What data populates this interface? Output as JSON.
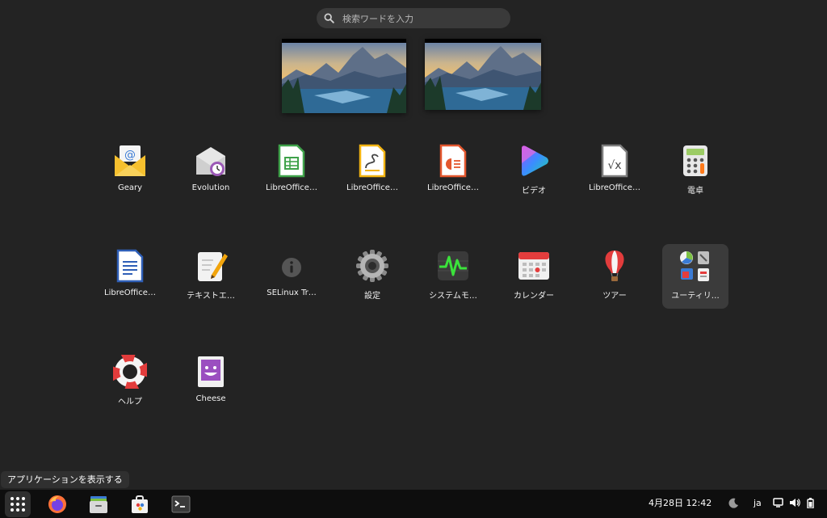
{
  "search": {
    "placeholder": "検索ワードを入力"
  },
  "apps": [
    {
      "label": "Geary",
      "icon": "geary-mail-icon"
    },
    {
      "label": "Evolution",
      "icon": "evolution-icon"
    },
    {
      "label": "LibreOffice…",
      "icon": "libreoffice-calc-icon"
    },
    {
      "label": "LibreOffice…",
      "icon": "libreoffice-draw-icon"
    },
    {
      "label": "LibreOffice…",
      "icon": "libreoffice-impress-icon"
    },
    {
      "label": "ビデオ",
      "icon": "videos-icon"
    },
    {
      "label": "LibreOffice…",
      "icon": "libreoffice-math-icon"
    },
    {
      "label": "電卓",
      "icon": "calculator-icon"
    },
    {
      "label": "LibreOffice…",
      "icon": "libreoffice-writer-icon"
    },
    {
      "label": "テキストエ…",
      "icon": "text-editor-icon"
    },
    {
      "label": "SELinux Tr…",
      "icon": "info-icon"
    },
    {
      "label": "設定",
      "icon": "settings-gear-icon"
    },
    {
      "label": "システムモ…",
      "icon": "system-monitor-icon"
    },
    {
      "label": "カレンダー",
      "icon": "calendar-icon"
    },
    {
      "label": "ツアー",
      "icon": "tour-balloon-icon"
    },
    {
      "label": "ユーティリ…",
      "icon": "utilities-folder-icon",
      "selected": true
    },
    {
      "label": "ヘルプ",
      "icon": "help-lifebuoy-icon"
    },
    {
      "label": "Cheese",
      "icon": "cheese-icon"
    }
  ],
  "tooltip": "アプリケーションを表示する",
  "dock": {
    "items": [
      "show-apps-icon",
      "firefox-icon",
      "files-icon",
      "software-icon",
      "terminal-icon"
    ]
  },
  "clock": "4月28日  12:42",
  "tray": {
    "lang": "ja",
    "icons": [
      "night-light-icon",
      "screen-icon",
      "volume-icon",
      "battery-icon"
    ]
  },
  "colors": {
    "background": "#232323",
    "dock": "#0e0e0e",
    "selected_tile": "#3b3b3b",
    "search": "#3a3a3a"
  }
}
